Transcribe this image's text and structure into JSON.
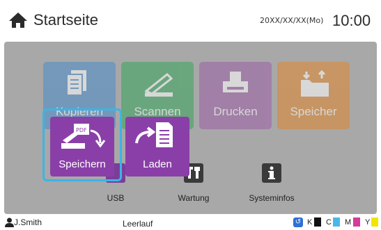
{
  "header": {
    "title": "Startseite",
    "date": "20XX/XX/XX(Mo)",
    "time": "10:00",
    "home_icon": "home-icon"
  },
  "tiles": [
    {
      "label": "Kopieren",
      "color": "#4a8cc8",
      "icon": "document-icon"
    },
    {
      "label": "Scannen",
      "color": "#37a55a",
      "icon": "scanner-icon"
    },
    {
      "label": "Drucken",
      "color": "#9c5fa7",
      "icon": "printer-icon"
    },
    {
      "label": "Speicher",
      "color": "#e0872c",
      "icon": "storage-folder-icon"
    }
  ],
  "small_items": [
    {
      "label": "USB",
      "icon": "usb-icon"
    },
    {
      "label": "Wartung",
      "icon": "tools-icon"
    },
    {
      "label": "Systeminfos",
      "icon": "info-icon"
    }
  ],
  "popup": {
    "save_label": "Speichern",
    "load_label": "Laden",
    "save_icon": "scan-to-pdf-icon",
    "load_icon": "load-document-icon",
    "selected_border_color": "#3cb4e6",
    "card_color": "#8a3fa8"
  },
  "status_bar": {
    "user": "J.Smith",
    "state": "Leerlauf",
    "ink": [
      {
        "label": "K",
        "color": "#111111"
      },
      {
        "label": "C",
        "color": "#49b8e8"
      },
      {
        "label": "M",
        "color": "#d63a9a"
      },
      {
        "label": "Y",
        "color": "#f2e600"
      }
    ]
  }
}
